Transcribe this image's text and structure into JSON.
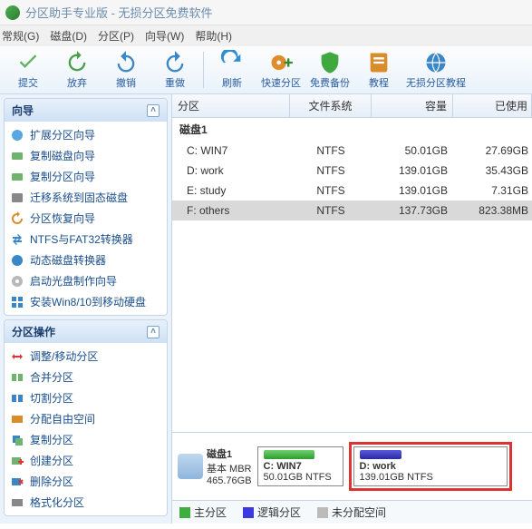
{
  "title": "分区助手专业版 - 无损分区免费软件",
  "menu": {
    "m0": "常规(G)",
    "m1": "磁盘(D)",
    "m2": "分区(P)",
    "m3": "向导(W)",
    "m4": "帮助(H)"
  },
  "toolbar": {
    "submit": "提交",
    "discard": "放弃",
    "undo": "撤销",
    "redo": "重做",
    "refresh": "刷新",
    "quick": "快速分区",
    "backup": "免费备份",
    "tutorial": "教程",
    "ntfsguide": "无损分区教程"
  },
  "panels": {
    "wizard": {
      "title": "向导",
      "items": [
        "扩展分区向导",
        "复制磁盘向导",
        "复制分区向导",
        "迁移系统到固态磁盘",
        "分区恢复向导",
        "NTFS与FAT32转换器",
        "动态磁盘转换器",
        "启动光盘制作向导",
        "安装Win8/10到移动硬盘"
      ]
    },
    "ops": {
      "title": "分区操作",
      "items": [
        "调整/移动分区",
        "合并分区",
        "切割分区",
        "分配自由空间",
        "复制分区",
        "创建分区",
        "删除分区",
        "格式化分区"
      ]
    }
  },
  "grid": {
    "headers": {
      "part": "分区",
      "fs": "文件系统",
      "cap": "容量",
      "used": "已使用"
    },
    "disk_label": "磁盘1",
    "rows": [
      {
        "name": "C: WIN7",
        "fs": "NTFS",
        "cap": "50.01GB",
        "used": "27.69GB"
      },
      {
        "name": "D: work",
        "fs": "NTFS",
        "cap": "139.01GB",
        "used": "35.43GB"
      },
      {
        "name": "E: study",
        "fs": "NTFS",
        "cap": "139.01GB",
        "used": "7.31GB"
      },
      {
        "name": "F: others",
        "fs": "NTFS",
        "cap": "137.73GB",
        "used": "823.38MB"
      }
    ]
  },
  "map": {
    "disk": {
      "name": "磁盘1",
      "type": "基本 MBR",
      "size": "465.76GB"
    },
    "p1": {
      "name": "C: WIN7",
      "info": "50.01GB NTFS"
    },
    "p2": {
      "name": "D: work",
      "info": "139.01GB NTFS"
    }
  },
  "legend": {
    "primary": "主分区",
    "logical": "逻辑分区",
    "free": "未分配空间"
  }
}
